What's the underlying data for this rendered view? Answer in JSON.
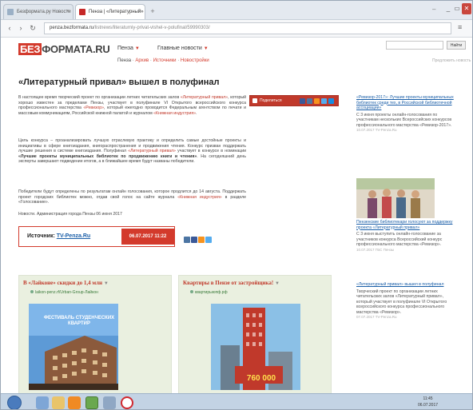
{
  "browser": {
    "tabs": [
      {
        "label": "Безформата.ру Новости"
      },
      {
        "label": "Пенза | «Литературный»"
      }
    ],
    "url_host": "penza.bezformata.ru",
    "url_path": "/listnews/literaturniy-privat-vishel-v-polufinal/59990303/",
    "search_button": "Найти"
  },
  "site": {
    "logo_prefix": "БЕЗ",
    "logo_rest": "ФОРМАТА.RU",
    "nav": [
      "Пенза",
      "Главные новости"
    ],
    "breadcrumb": [
      "Пенза",
      "Архив",
      "Источники",
      "Новостройки"
    ],
    "edit_link": "Предложить новость"
  },
  "article": {
    "title": "«Литературный привал» вышел в полуфинал",
    "p1_start": "В настоящее время творческий проект по организации летних читательских залов ",
    "p1_link1": "«Литературный привал»",
    "p1_mid1": ", который хорошо известен за пределами Пензы, участвует в полуфинале VI Открытого всероссийского конкурса профессионального мастерства ",
    "p1_link2": "«Ревизор»",
    "p1_mid2": ", который ежегодно проводится Федеральным агентством по печати и массовым коммуникациям, Российской книжной палатой и журналом ",
    "p1_link3": "«Книжная индустрия»",
    "p1_end": ".",
    "p2_start": "Цель конкурса – проанализировать лучшую отраслевую практику и определить самые достойные проекты и инициативы в сфере книгоиздания, книгораспространения и продвижения чтения. Конкурс призван поддержать лучшие решения в системе книгоиздания. Полуфинал ",
    "p2_link": "«Литературный привал»",
    "p2_mid": " участвует в конкурсе в номинации ",
    "p2_bold": "«Лучшие проекты муниципальных библиотек по продвижению книги и чтения»",
    "p2_end": ". На сегодняшний день эксперты завершают подведение итогов, а в ближайшее время будут названы победители.",
    "p3_start": "Победители будут определены по результатам онлайн голосования, которое продлится до 14 августа. Поддержать проект городских библиотек можно, отдав свой голос на сайте журнала ",
    "p3_link": "«Книжная индустрия»",
    "p3_end": " в разделе «Голосование».",
    "p4": "Новости. Администрация города Пензы 06 июня 2017",
    "share_label": "Поделиться",
    "source_label": "Источник:",
    "source_name": "TV-Penza.Ru",
    "source_date": "06.07.2017  11:22"
  },
  "ads": [
    {
      "title": "В «Лайконе» скидки до 1,4 млн",
      "url": "laikon-penz.rf/Urban-Group-Лайкон",
      "banner": "ФЕСТИВАЛЬ СТУДЕНЧЕСКИХ КВАРТИР"
    },
    {
      "title": "Квартиры в Пензе от застройщика!",
      "url": "квартирыюпф.рф",
      "banner_price": "760 000"
    }
  ],
  "sidebar": {
    "item1_link": "«Ревизор-2017»: Лучшие проекты муниципальных библиотек среди тех, в Российской библиотечной ассоциации»",
    "item1_text": "С 3 июня проекты онлайн-голосования по участникам нескольких Всероссийских конкурсов профессионального мастерства «Ревизор-2017».",
    "item1_meta": "10.07.2017 TV-Penza.Ru",
    "item2_link": "Пензенские библиотекари голосуют за поддержку проекта «Литературный привал»",
    "item2_text": "С 3 июня выступить онлайн-голосование за участников конкурса Всероссийский конкурс профессионального мастерства «Ревизор».",
    "item2_meta": "10.07.2017 ГБС Пензы",
    "item3_link": "«Литературный привал» вышел в полуфинал",
    "item3_text": "Творческий проект по организации летних читательских залов «Литературный привал», который участвует в полуфинале VI Открытого всероссийского конкурса профессионального мастерства «Ревизор».",
    "item3_meta": "07.07.2017 TV-Penza.Ru"
  },
  "taskbar": {
    "time": "11:45",
    "date": "06.07.2017"
  }
}
